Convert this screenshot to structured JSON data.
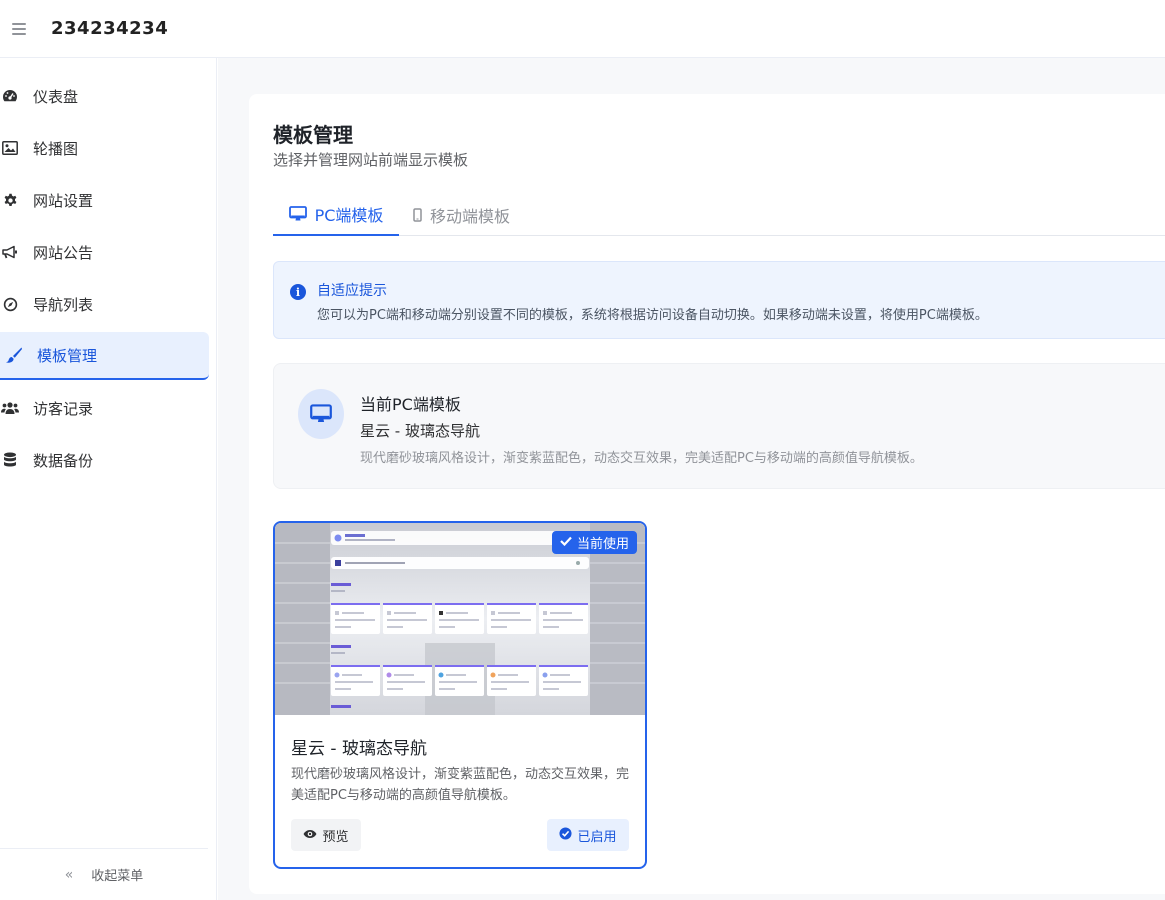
{
  "app": {
    "title": "234234234"
  },
  "sidebar": {
    "items": [
      {
        "label": "仪表盘",
        "icon": "dashboard-icon"
      },
      {
        "label": "轮播图",
        "icon": "image-icon"
      },
      {
        "label": "网站设置",
        "icon": "gear-icon"
      },
      {
        "label": "网站公告",
        "icon": "megaphone-icon"
      },
      {
        "label": "导航列表",
        "icon": "compass-icon"
      },
      {
        "label": "模板管理",
        "icon": "brush-icon",
        "active": true
      },
      {
        "label": "访客记录",
        "icon": "users-icon"
      },
      {
        "label": "数据备份",
        "icon": "database-icon"
      }
    ],
    "collapse_label": "收起菜单"
  },
  "page": {
    "title": "模板管理",
    "subtitle": "选择并管理网站前端显示模板"
  },
  "tabs": [
    {
      "label": "PC端模板",
      "active": true
    },
    {
      "label": "移动端模板",
      "active": false
    }
  ],
  "alert": {
    "title": "自适应提示",
    "description": "您可以为PC端和移动端分别设置不同的模板，系统将根据访问设备自动切换。如果移动端未设置，将使用PC端模板。"
  },
  "current_template": {
    "label": "当前PC端模板",
    "name": "星云 - 玻璃态导航",
    "description": "现代磨砂玻璃风格设计，渐变紫蓝配色，动态交互效果，完美适配PC与移动端的高颜值导航模板。"
  },
  "template_card": {
    "badge": "当前使用",
    "title": "星云 - 玻璃态导航",
    "description": "现代磨砂玻璃风格设计，渐变紫蓝配色，动态交互效果，完美适配PC与移动端的高颜值导航模板。",
    "preview_label": "预览",
    "enabled_label": "已启用"
  },
  "colors": {
    "accent": "#2563eb",
    "accent_bg": "#e8f0fe"
  }
}
